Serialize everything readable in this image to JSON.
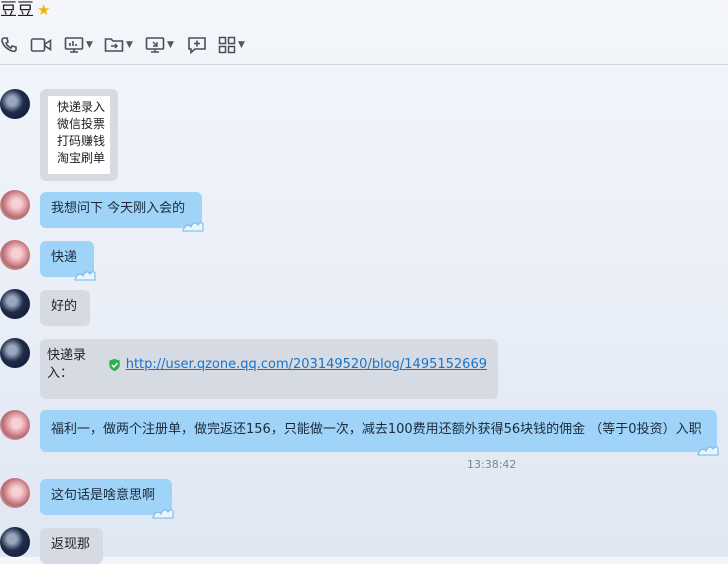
{
  "header": {
    "title": "豆豆",
    "star_icon": "star-icon"
  },
  "toolbar": {
    "items": [
      {
        "name": "voice-call-icon"
      },
      {
        "name": "video-call-icon"
      },
      {
        "name": "screen-share-icon"
      },
      {
        "name": "file-transfer-icon"
      },
      {
        "name": "remote-desktop-icon"
      },
      {
        "name": "add-chat-icon"
      },
      {
        "name": "apps-grid-icon"
      }
    ]
  },
  "messages": [
    {
      "side": "left",
      "avatar": "dark",
      "type": "image",
      "lines": [
        "快递录入",
        "微信投票",
        "打码赚钱",
        "淘宝刷单"
      ]
    },
    {
      "side": "left",
      "avatar": "girl",
      "type": "text",
      "bubble": "blue",
      "text": "我想问下 今天刚入会的"
    },
    {
      "side": "left",
      "avatar": "girl",
      "type": "text",
      "bubble": "blue",
      "text": "快递"
    },
    {
      "side": "left",
      "avatar": "dark",
      "type": "text",
      "bubble": "grey",
      "text": "好的"
    },
    {
      "side": "left",
      "avatar": "dark",
      "type": "link",
      "bubble": "grey",
      "label": "快递录入：",
      "url": "http://user.qzone.qq.com/203149520/blog/1495152669"
    },
    {
      "side": "left",
      "avatar": "girl",
      "type": "text",
      "bubble": "blue",
      "text": "福利一，做两个注册单，做完返还156，只能做一次，减去100费用还额外获得56块钱的佣金 （等于0投资）入职"
    },
    {
      "side": "left",
      "avatar": "girl",
      "type": "text",
      "bubble": "blue",
      "text": "这句话是啥意思啊"
    },
    {
      "side": "left",
      "avatar": "dark",
      "type": "text",
      "bubble": "grey",
      "text": "返现那"
    }
  ],
  "timestamp": "13:38:42",
  "colors": {
    "blue_bubble": "#9fd3f7",
    "grey_bubble": "#d6dbe3",
    "link": "#1a73c8",
    "verified": "#2bb24c"
  }
}
